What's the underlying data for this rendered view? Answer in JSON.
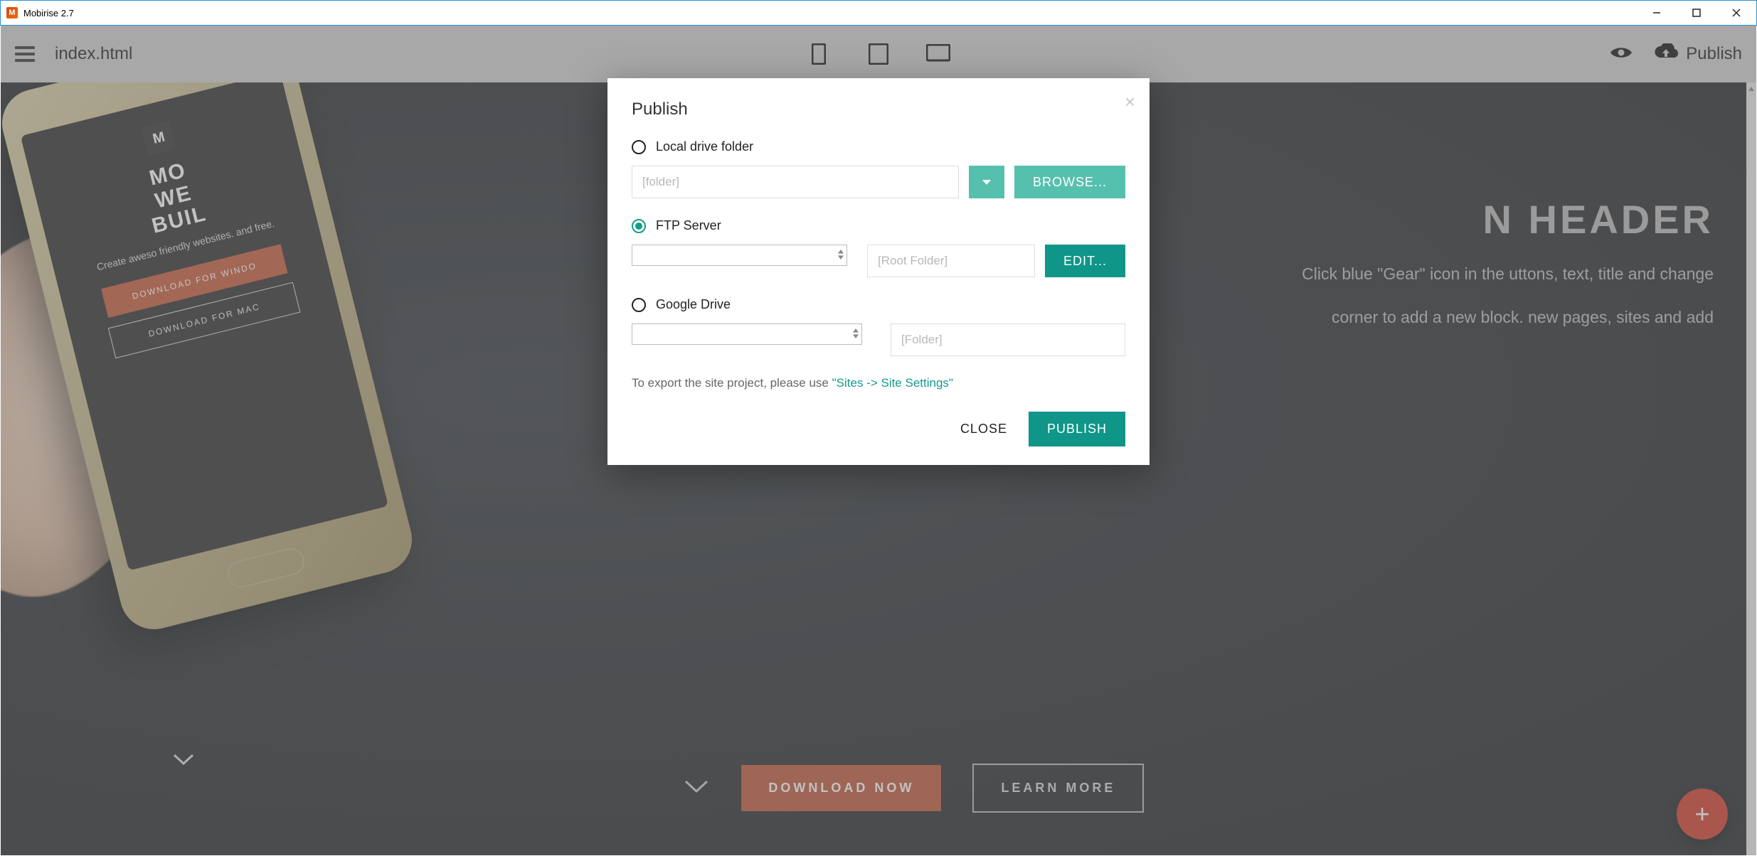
{
  "window": {
    "title": "Mobirise 2.7"
  },
  "toolbar": {
    "page_name": "index.html",
    "publish_label": "Publish"
  },
  "hero": {
    "heading_fragment": "N HEADER",
    "para1": "Click blue \"Gear\" icon in the uttons, text, title and change",
    "para2": "corner to add a new block. new pages, sites and add",
    "download_now": "DOWNLOAD NOW",
    "learn_more": "LEARN MORE"
  },
  "phone": {
    "title_l1": "MO",
    "title_l2": "WE",
    "title_l3": "BUIL",
    "sub": "Create aweso friendly websites. and free.",
    "btn1": "DOWNLOAD FOR WINDO",
    "btn2": "DOWNLOAD FOR MAC"
  },
  "modal": {
    "title": "Publish",
    "local": {
      "label": "Local drive folder",
      "placeholder": "[folder]",
      "browse": "BROWSE..."
    },
    "ftp": {
      "label": "FTP Server",
      "root_placeholder": "[Root Folder]",
      "edit": "EDIT..."
    },
    "gdrive": {
      "label": "Google Drive",
      "folder_placeholder": "[Folder]"
    },
    "export_hint_pre": "To export the site project, please use ",
    "export_hint_link": "\"Sites -> Site Settings\"",
    "close": "CLOSE",
    "publish": "PUBLISH"
  },
  "fab": {
    "plus": "+"
  }
}
